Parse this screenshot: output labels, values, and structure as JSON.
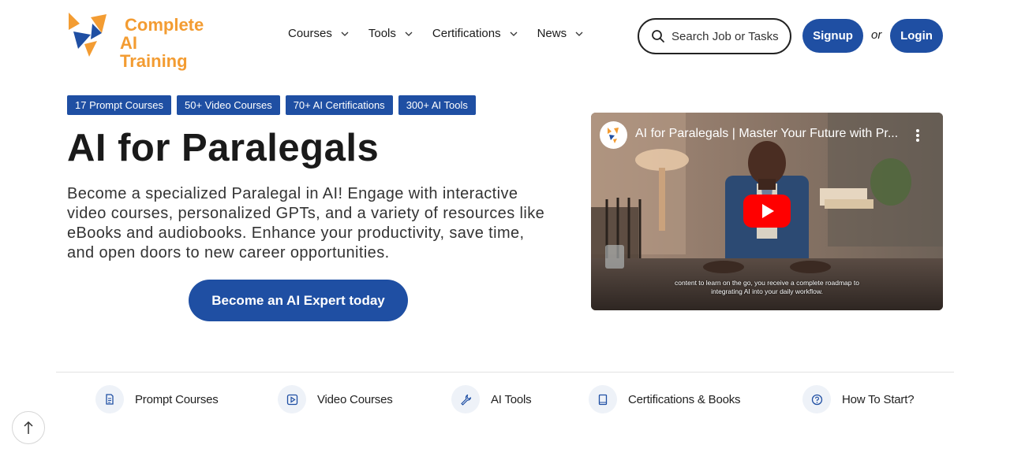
{
  "brand": {
    "line1": "Complete",
    "line2": "AI Training",
    "accent": "#f39c32",
    "primary": "#1f4fa3"
  },
  "nav": {
    "items": [
      {
        "label": "Courses"
      },
      {
        "label": "Tools"
      },
      {
        "label": "Certifications"
      },
      {
        "label": "News"
      }
    ]
  },
  "search": {
    "placeholder": "Search Job or Tasks"
  },
  "auth": {
    "signup": "Signup",
    "or": "or",
    "login": "Login"
  },
  "badges": [
    "17 Prompt Courses",
    "50+ Video Courses",
    "70+ AI Certifications",
    "300+ AI Tools"
  ],
  "hero": {
    "title": "AI for Paralegals",
    "description": "Become a specialized Paralegal in AI! Engage with interactive video courses, personalized GPTs, and a variety of resources like eBooks and audiobooks. Enhance your productivity, save time, and open doors to new career opportunities.",
    "cta": "Become an AI Expert today"
  },
  "video": {
    "title": "AI for Paralegals | Master Your Future with Pr...",
    "caption_line1": "content to learn on the go, you receive a complete roadmap to",
    "caption_line2": "integrating AI into your daily workflow.",
    "icons": {
      "menu": "more-vert-icon",
      "play": "play-icon"
    }
  },
  "bottom_nav": [
    {
      "label": "Prompt Courses",
      "icon": "document-icon"
    },
    {
      "label": "Video Courses",
      "icon": "video-play-icon"
    },
    {
      "label": "AI Tools",
      "icon": "wrench-icon"
    },
    {
      "label": "Certifications & Books",
      "icon": "book-icon"
    },
    {
      "label": "How To Start?",
      "icon": "help-icon"
    }
  ]
}
